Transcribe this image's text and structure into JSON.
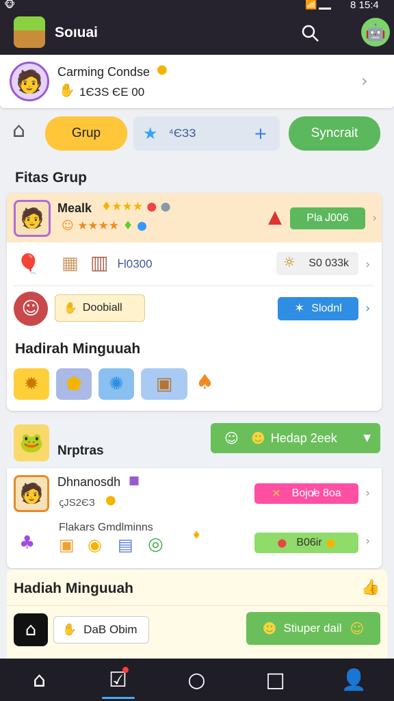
{
  "status": {
    "time": "8 15:4",
    "wifi_icon": "wifi-icon",
    "signal_icon": "signal-icon",
    "battery_icon": "battery-icon"
  },
  "appbar": {
    "title": "Soıuai",
    "logo_icon": "game-logo-icon",
    "search_icon": "search-icon",
    "avatar_icon": "user-avatar-icon"
  },
  "profile": {
    "name": "Carming Condse",
    "coins": "1ЄЗЅ ЄЕ 00"
  },
  "actions": {
    "grup_label": "Grup",
    "search_value": "⁴ЄЗЗ",
    "sync_label": "Syncrait"
  },
  "section1": {
    "title": "Fitas Grup",
    "rows": [
      {
        "name": "Mealk",
        "button": "Pla Ꭻ006"
      },
      {
        "text": "Ꮀl0300",
        "button": "S0 033k"
      },
      {
        "chip": "Doobiall",
        "button": "Slodnl"
      }
    ],
    "weekly_title": "Hadirah Minguuah"
  },
  "section2": {
    "title": "Nrptras",
    "dropdown": "Hedap 2eek",
    "rows": [
      {
        "name": "Dhnanosdh",
        "meta": "ꞔJS2ЄЗ",
        "button": "Bojo̸e 8oa"
      },
      {
        "name": "Flakars Gmdlminns",
        "button": "B06ir"
      }
    ]
  },
  "section3": {
    "title": "Hadiah Minguuah",
    "chip": "DaB Obim",
    "button": "Stiuper dail"
  },
  "colors": {
    "bar": "#26232f",
    "green": "#5cb85c",
    "yellow": "#ffc93c",
    "blue": "#2f8de4",
    "pink": "#ff4fa3"
  }
}
